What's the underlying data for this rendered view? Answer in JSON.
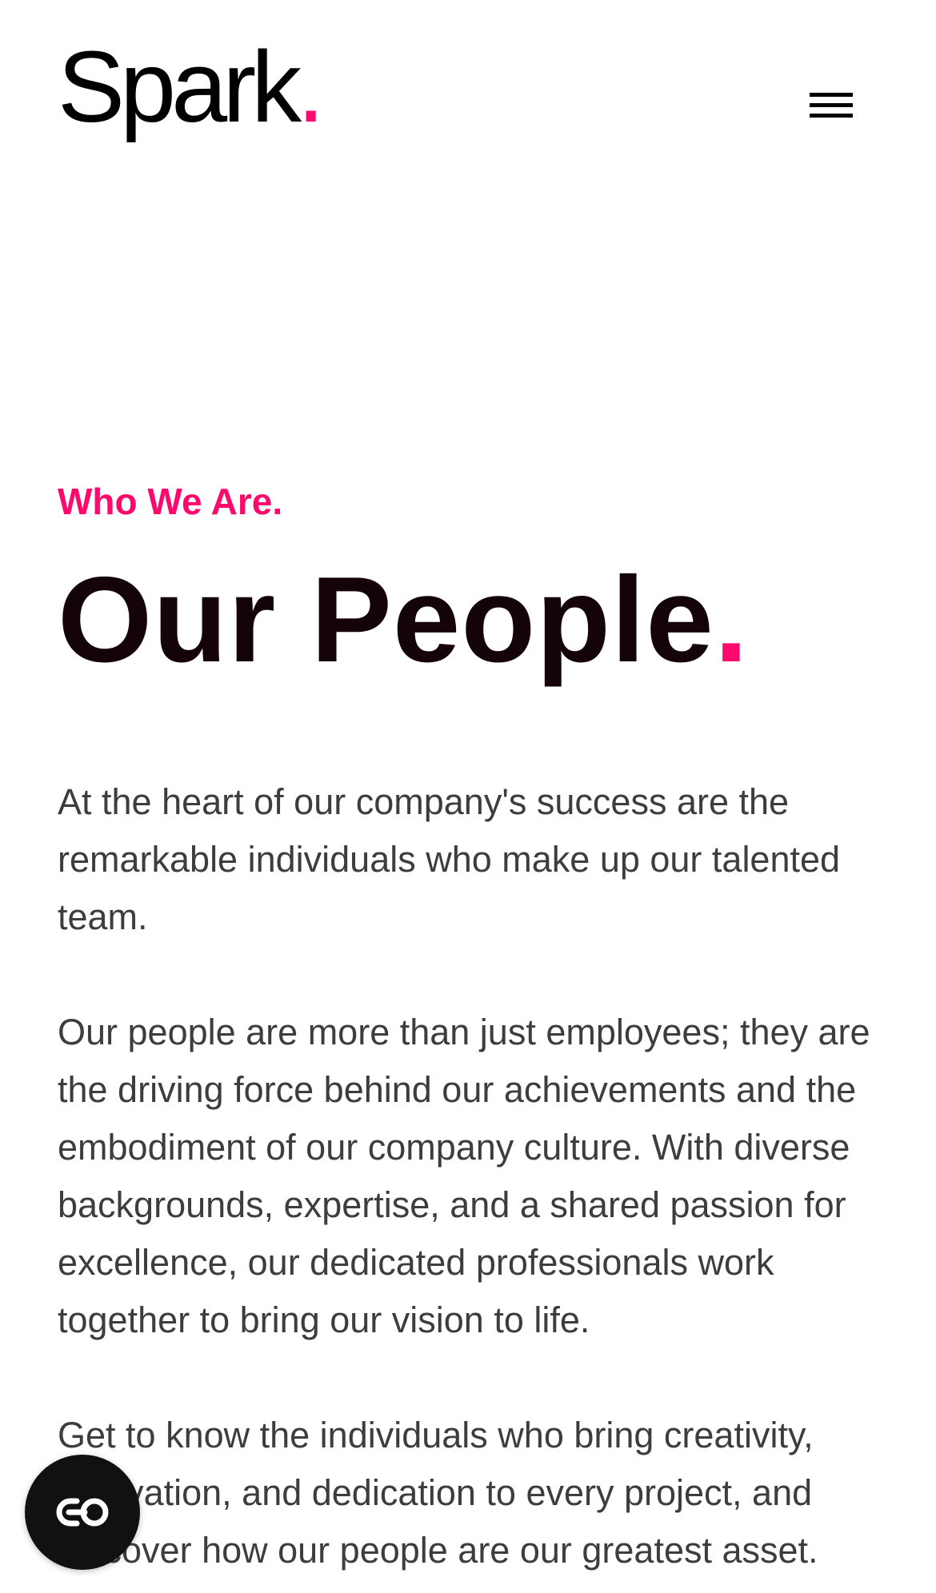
{
  "header": {
    "logo_text": "Spark",
    "logo_dot": ".",
    "menu_icon": "hamburger-menu-icon"
  },
  "hero": {
    "eyebrow": "Who We Are.",
    "title": "Our People",
    "title_dot": "."
  },
  "body": {
    "paragraphs": [
      "At the heart of our company's success are the remarkable individuals who make up our talented team.",
      "Our people are more than just employees; they are the driving force behind our achievements and the embodiment of our company culture. With diverse backgrounds, expertise, and a shared passion for excellence, our dedicated professionals work together to bring our vision to life.",
      "Get to know the individuals who bring creativity, innovation, and dedication to every project, and discover how our people are our greatest asset."
    ]
  },
  "floating": {
    "chat_icon": "chat-widget-icon"
  },
  "colors": {
    "accent": "#ff0a6c",
    "title": "#14040a",
    "body_text": "#3d3d3d",
    "background": "#ffffff",
    "chat_button": "#111111"
  }
}
